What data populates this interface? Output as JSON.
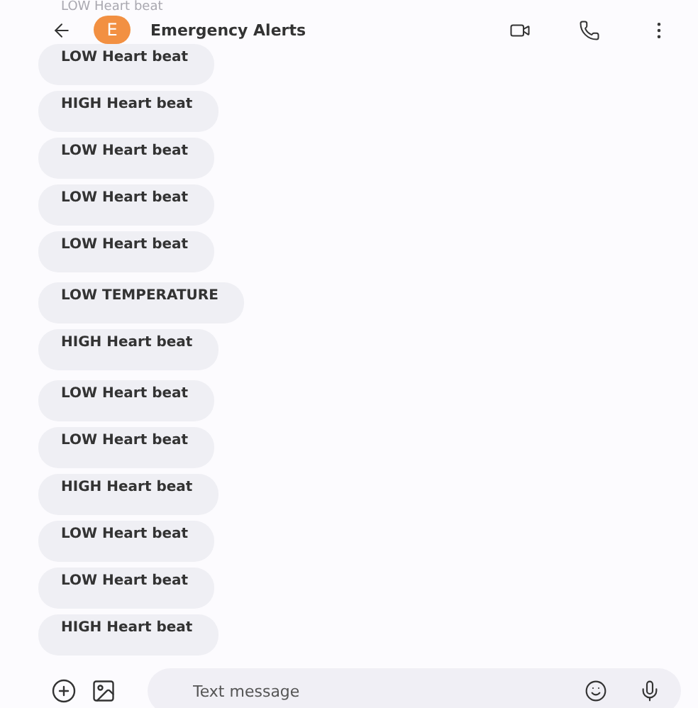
{
  "partially_hidden_message": "LOW Heart beat",
  "header": {
    "avatar_letter": "E",
    "title": "Emergency Alerts"
  },
  "message_groups": [
    {
      "messages": [
        "LOW Heart beat",
        "HIGH Heart beat",
        "LOW Heart beat",
        "LOW Heart beat",
        "LOW Heart beat"
      ]
    },
    {
      "messages": [
        "LOW TEMPERATURE",
        "HIGH Heart beat"
      ]
    },
    {
      "messages": [
        "LOW Heart beat",
        "LOW Heart beat",
        "HIGH Heart beat",
        "LOW Heart beat",
        "LOW Heart beat",
        "HIGH Heart beat"
      ]
    }
  ],
  "composer": {
    "placeholder": "Text message"
  }
}
